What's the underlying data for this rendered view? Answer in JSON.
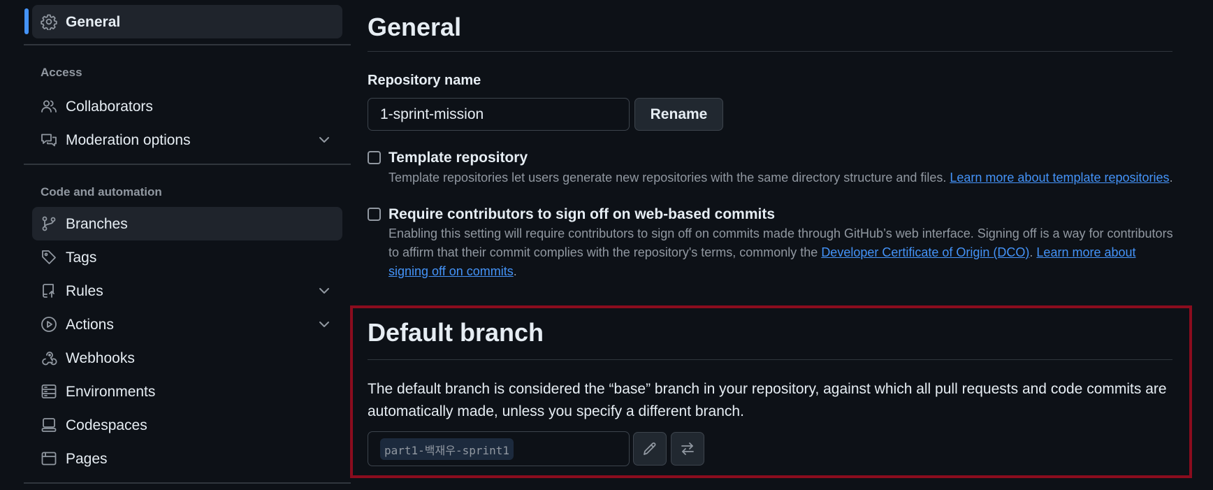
{
  "sidebar": {
    "general": {
      "label": "General",
      "icon": "gear-icon"
    },
    "access_heading": "Access",
    "collaborators": {
      "label": "Collaborators",
      "icon": "people-icon"
    },
    "moderation": {
      "label": "Moderation options",
      "icon": "comment-discussion-icon"
    },
    "code_heading": "Code and automation",
    "branches": {
      "label": "Branches",
      "icon": "git-branch-icon"
    },
    "tags": {
      "label": "Tags",
      "icon": "tag-icon"
    },
    "rules": {
      "label": "Rules",
      "icon": "repo-push-icon"
    },
    "actions": {
      "label": "Actions",
      "icon": "play-icon"
    },
    "webhooks": {
      "label": "Webhooks",
      "icon": "webhook-icon"
    },
    "environments": {
      "label": "Environments",
      "icon": "server-icon"
    },
    "codespaces": {
      "label": "Codespaces",
      "icon": "codespaces-icon"
    },
    "pages": {
      "label": "Pages",
      "icon": "browser-icon"
    }
  },
  "main": {
    "title": "General",
    "repo_name_label": "Repository name",
    "repo_name_value": "1-sprint-mission",
    "rename_button": "Rename",
    "template": {
      "title": "Template repository",
      "desc": "Template repositories let users generate new repositories with the same directory structure and files. ",
      "link": "Learn more about template repositories",
      "end": ".",
      "checked": false
    },
    "signoff": {
      "title": "Require contributors to sign off on web-based commits",
      "desc": "Enabling this setting will require contributors to sign off on commits made through GitHub’s web interface. Signing off is a way for contributors to affirm that their commit complies with the repository's terms, commonly the ",
      "link1": "Developer Certificate of Origin (DCO)",
      "mid": ". ",
      "link2": "Learn more about signing off on commits",
      "end": ".",
      "checked": false
    },
    "default_branch": {
      "title": "Default branch",
      "desc": "The default branch is considered the “base” branch in your repository, against which all pull requests and code commits are automatically made, unless you specify a different branch.",
      "branch_name": "part1-백재우-sprint1",
      "edit_icon": "pencil-icon",
      "switch_icon": "arrow-switch-icon"
    }
  },
  "colors": {
    "background": "#0d1117",
    "accent": "#4493f8",
    "highlight_border": "#8b0c1e",
    "muted": "#9198a1"
  }
}
